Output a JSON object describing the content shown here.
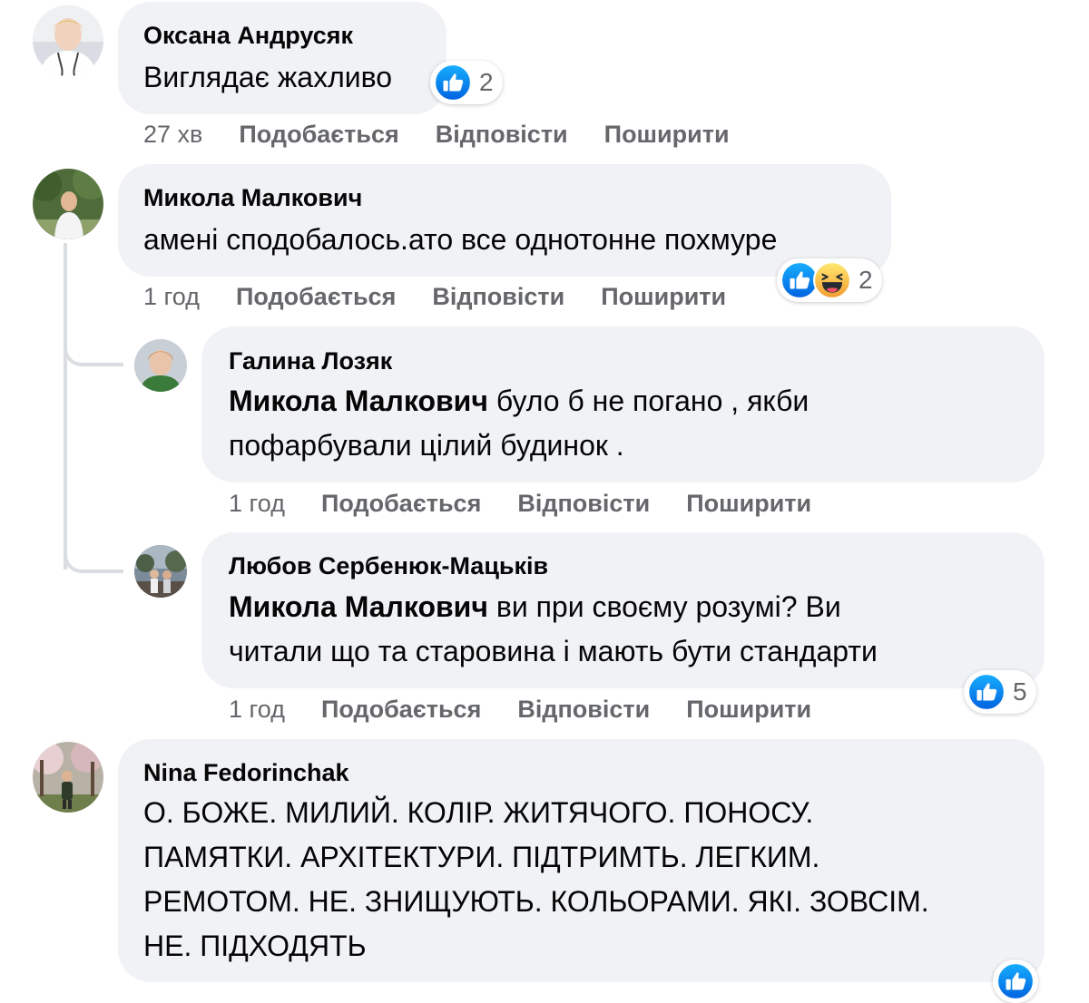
{
  "comments": [
    {
      "author": "Оксана Андрусяк",
      "text": "Виглядає жахливо",
      "time": "27 хв",
      "like": "Подобається",
      "reply": "Відповісти",
      "share": "Поширити",
      "reactions": {
        "types": [
          "like-icon"
        ],
        "count": "2"
      }
    },
    {
      "author": "Микола Малкович",
      "text": "амені сподобалось.ато все однотонне похмуре",
      "time": "1 год",
      "like": "Подобається",
      "reply": "Відповісти",
      "share": "Поширити",
      "reactions": {
        "types": [
          "like-icon",
          "haha-icon"
        ],
        "count": "2"
      },
      "replies": [
        {
          "author": "Галина Лозяк",
          "mention": "Микола Малкович",
          "text_line1": " було б не погано , якби",
          "text_line2": "пофарбували цілий будинок .",
          "time": "1 год",
          "like": "Подобається",
          "reply": "Відповісти",
          "share": "Поширити"
        },
        {
          "author": "Любов Сербенюк-Мацьків",
          "mention": "Микола Малкович",
          "text_line1": " ви при своєму розумі? Ви",
          "text_line2": "читали що та старовина і мають бути стандарти",
          "time": "1 год",
          "like": "Подобається",
          "reply": "Відповісти",
          "share": "Поширити",
          "reactions": {
            "types": [
              "like-icon"
            ],
            "count": "5"
          }
        }
      ]
    },
    {
      "author": "Nina Fedorinchak",
      "lines": [
        "О. БОЖЕ. МИЛИЙ. КОЛІР. ЖИТЯЧОГО. ПОНОСУ.",
        "ПАМЯТКИ. АРХІТЕКТУРИ. ПІДТРИМТЬ. ЛЕГКИМ.",
        "РЕМОТОМ. НЕ. ЗНИЩУЮТЬ. КОЛЬОРАМИ. ЯКІ. ЗОВСІМ.",
        "НЕ. ПІДХОДЯТЬ"
      ],
      "reactions": {
        "types": [
          "like-icon"
        ]
      }
    }
  ],
  "colors": {
    "bubble": "#f0f2f5",
    "meta_text": "#65676b",
    "like_blue": "#1877f2",
    "haha_yellow": "#f7b125"
  }
}
